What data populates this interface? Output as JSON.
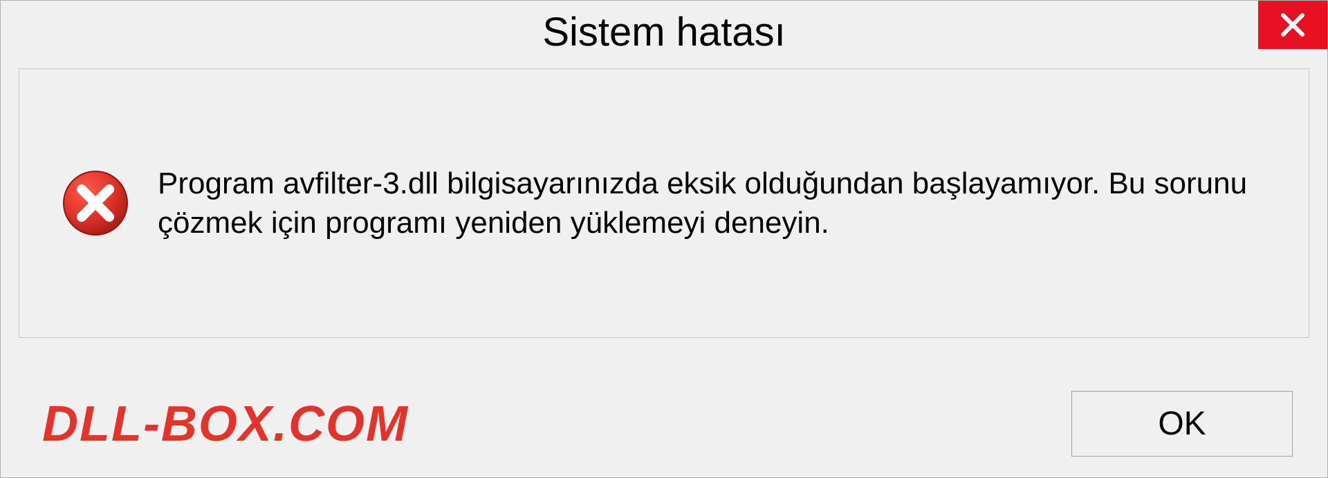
{
  "titlebar": {
    "title": "Sistem hatası"
  },
  "content": {
    "message": "Program avfilter-3.dll bilgisayarınızda eksik olduğundan başlayamıyor. Bu sorunu çözmek için programı yeniden yüklemeyi deneyin."
  },
  "footer": {
    "watermark": "DLL-BOX.COM",
    "ok_label": "OK"
  }
}
